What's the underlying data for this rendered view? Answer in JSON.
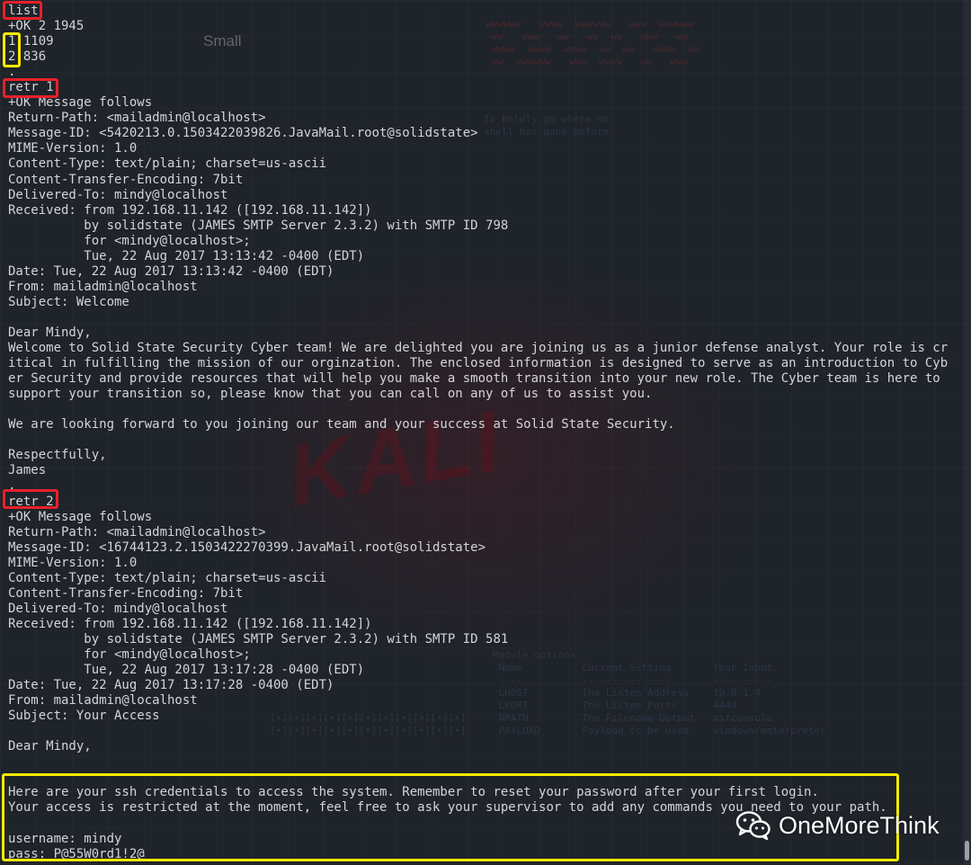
{
  "background": {
    "small_label": "Small"
  },
  "terminal": {
    "lines": [
      "list",
      "+OK 2 1945",
      "1 1109",
      "2 836",
      ".",
      "retr 1",
      "+OK Message follows",
      "Return-Path: <mailadmin@localhost>",
      "Message-ID: <5420213.0.1503422039826.JavaMail.root@solidstate>",
      "MIME-Version: 1.0",
      "Content-Type: text/plain; charset=us-ascii",
      "Content-Transfer-Encoding: 7bit",
      "Delivered-To: mindy@localhost",
      "Received: from 192.168.11.142 ([192.168.11.142])",
      "          by solidstate (JAMES SMTP Server 2.3.2) with SMTP ID 798",
      "          for <mindy@localhost>;",
      "          Tue, 22 Aug 2017 13:13:42 -0400 (EDT)",
      "Date: Tue, 22 Aug 2017 13:13:42 -0400 (EDT)",
      "From: mailadmin@localhost",
      "Subject: Welcome",
      "",
      "Dear Mindy,",
      "Welcome to Solid State Security Cyber team! We are delighted you are joining us as a junior defense analyst. Your role is cr",
      "itical in fulfilling the mission of our orginzation. The enclosed information is designed to serve as an introduction to Cyb",
      "er Security and provide resources that will help you make a smooth transition into your new role. The Cyber team is here to",
      "support your transition so, please know that you can call on any of us to assist you.",
      "",
      "We are looking forward to you joining our team and your success at Solid State Security.",
      "",
      "Respectfully,",
      "James",
      ".",
      "retr 2",
      "+OK Message follows",
      "Return-Path: <mailadmin@localhost>",
      "Message-ID: <16744123.2.1503422270399.JavaMail.root@solidstate>",
      "MIME-Version: 1.0",
      "Content-Type: text/plain; charset=us-ascii",
      "Content-Transfer-Encoding: 7bit",
      "Delivered-To: mindy@localhost",
      "Received: from 192.168.11.142 ([192.168.11.142])",
      "          by solidstate (JAMES SMTP Server 2.3.2) with SMTP ID 581",
      "          for <mindy@localhost>;",
      "          Tue, 22 Aug 2017 13:17:28 -0400 (EDT)",
      "Date: Tue, 22 Aug 2017 13:17:28 -0400 (EDT)",
      "From: mailadmin@localhost",
      "Subject: Your Access",
      "",
      "Dear Mindy,",
      "",
      "",
      "Here are your ssh credentials to access the system. Remember to reset your password after your first login.",
      "Your access is restricted at the moment, feel free to ask your supervisor to add any commands you need to your path.",
      "",
      "username: mindy",
      "pass: P@55W0rd1!2@"
    ]
  },
  "watermark": {
    "text": "OneMoreThink",
    "icon": "wechat-icon"
  },
  "colors": {
    "background": "#1f232a",
    "text": "#d3d5d8",
    "highlight_red": "#e8202a",
    "highlight_yellow": "#f6ea00"
  }
}
